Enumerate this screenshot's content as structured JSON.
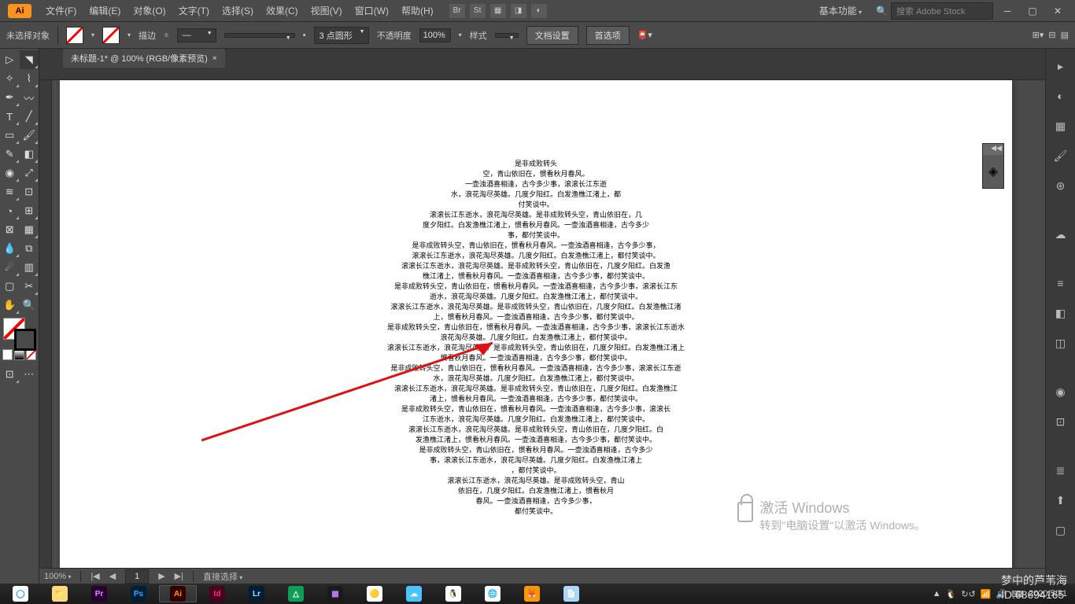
{
  "menu": {
    "app_icon": "Ai",
    "items": [
      "文件(F)",
      "编辑(E)",
      "对象(O)",
      "文字(T)",
      "选择(S)",
      "效果(C)",
      "视图(V)",
      "窗口(W)",
      "帮助(H)"
    ],
    "icons": [
      "Br",
      "St",
      "▦",
      "◨",
      "◐"
    ],
    "basic_fn": "基本功能",
    "search_placeholder": "搜索 Adobe Stock"
  },
  "control": {
    "no_selection": "未选择对象",
    "stroke_label": "描边",
    "stroke_list": "—",
    "stroke_width": "3 点圆形",
    "opacity_label": "不透明度",
    "opacity_value": "100%",
    "style_label": "样式",
    "doc_setup": "文档设置",
    "prefs": "首选项"
  },
  "tab": {
    "title": "未标题-1* @ 100% (RGB/像素预览)",
    "close": "×"
  },
  "status": {
    "zoom": "100%",
    "nav_page": "1",
    "tool": "直接选择"
  },
  "watermark": {
    "title": "激活 Windows",
    "sub": "转到\"电脑设置\"以激活 Windows。"
  },
  "overlay": {
    "line1": "梦中的芦苇海",
    "line2": "ID:68694165"
  },
  "tray": {
    "date": "2020/5/31"
  },
  "nav_panel": {
    "collapse": "◀◀"
  },
  "poem": {
    "lines": [
      "是非成败转头",
      "空，青山依旧在，惯看秋月春风。",
      "一壶浊酒喜相逢，古今多少事，滚滚长江东逝",
      "水，浪花淘尽英雄。几度夕阳红。白发渔樵江渚上，都",
      "付笑谈中。",
      "滚滚长江东逝水，浪花淘尽英雄。是非成败转头空，青山依旧在，几",
      "度夕阳红。白发渔樵江渚上，惯看秋月春风。一壶浊酒喜相逢，古今多少",
      "事，都付笑谈中。",
      "是非成败转头空，青山依旧在，惯看秋月春风。一壶浊酒喜相逢，古今多少事，",
      "滚滚长江东逝水，浪花淘尽英雄。几度夕阳红。白发渔樵江渚上，都付笑谈中。",
      "滚滚长江东逝水，浪花淘尽英雄。是非成败转头空，青山依旧在，几度夕阳红。白发渔",
      "樵江渚上，惯看秋月春风。一壶浊酒喜相逢，古今多少事，都付笑谈中。",
      "是非成败转头空，青山依旧在，惯看秋月春风。一壶浊酒喜相逢，古今多少事，滚滚长江东",
      "逝水，浪花淘尽英雄。几度夕阳红。白发渔樵江渚上，都付笑谈中。",
      "滚滚长江东逝水，浪花淘尽英雄。是非成败转头空，青山依旧在，几度夕阳红。白发渔樵江渚",
      "上，惯看秋月春风。一壶浊酒喜相逢，古今多少事，都付笑谈中。",
      "是非成败转头空，青山依旧在，惯看秋月春风。一壶浊酒喜相逢，古今多少事，滚滚长江东逝水",
      "浪花淘尽英雄。几度夕阳红。白发渔樵江渚上，都付笑谈中。",
      "滚滚长江东逝水，浪花淘尽英雄。是非成败转头空，青山依旧在，几度夕阳红。白发渔樵江渚上",
      "惯看秋月春风。一壶浊酒喜相逢，古今多少事，都付笑谈中。",
      "是非成败转头空，青山依旧在，惯看秋月春风。一壶浊酒喜相逢，古今多少事，滚滚长江东逝",
      "水，浪花淘尽英雄。几度夕阳红。白发渔樵江渚上，都付笑谈中。",
      "滚滚长江东逝水，浪花淘尽英雄。是非成败转头空，青山依旧在，几度夕阳红。白发渔樵江",
      "渚上，惯看秋月春风。一壶浊酒喜相逢，古今多少事，都付笑谈中。",
      "是非成败转头空，青山依旧在，惯看秋月春风。一壶浊酒喜相逢，古今多少事，滚滚长",
      "江东逝水，浪花淘尽英雄。几度夕阳红。白发渔樵江渚上，都付笑谈中。",
      "滚滚长江东逝水，浪花淘尽英雄。是非成败转头空，青山依旧在，几度夕阳红。白",
      "发渔樵江渚上，惯看秋月春风。一壶浊酒喜相逢，古今多少事，都付笑谈中。",
      "是非成败转头空，青山依旧在，惯看秋月春风。一壶浊酒喜相逢，古今多少",
      "事，滚滚长江东逝水，浪花淘尽英雄。几度夕阳红。白发渔樵江渚上",
      "，都付笑谈中。",
      "滚滚长江东逝水，浪花淘尽英雄。是非成败转头空，青山",
      "依旧在，几度夕阳红。白发渔樵江渚上，惯看秋月",
      "春风。一壶浊酒喜相逢，古今多少事，",
      "都付笑谈中。"
    ]
  }
}
